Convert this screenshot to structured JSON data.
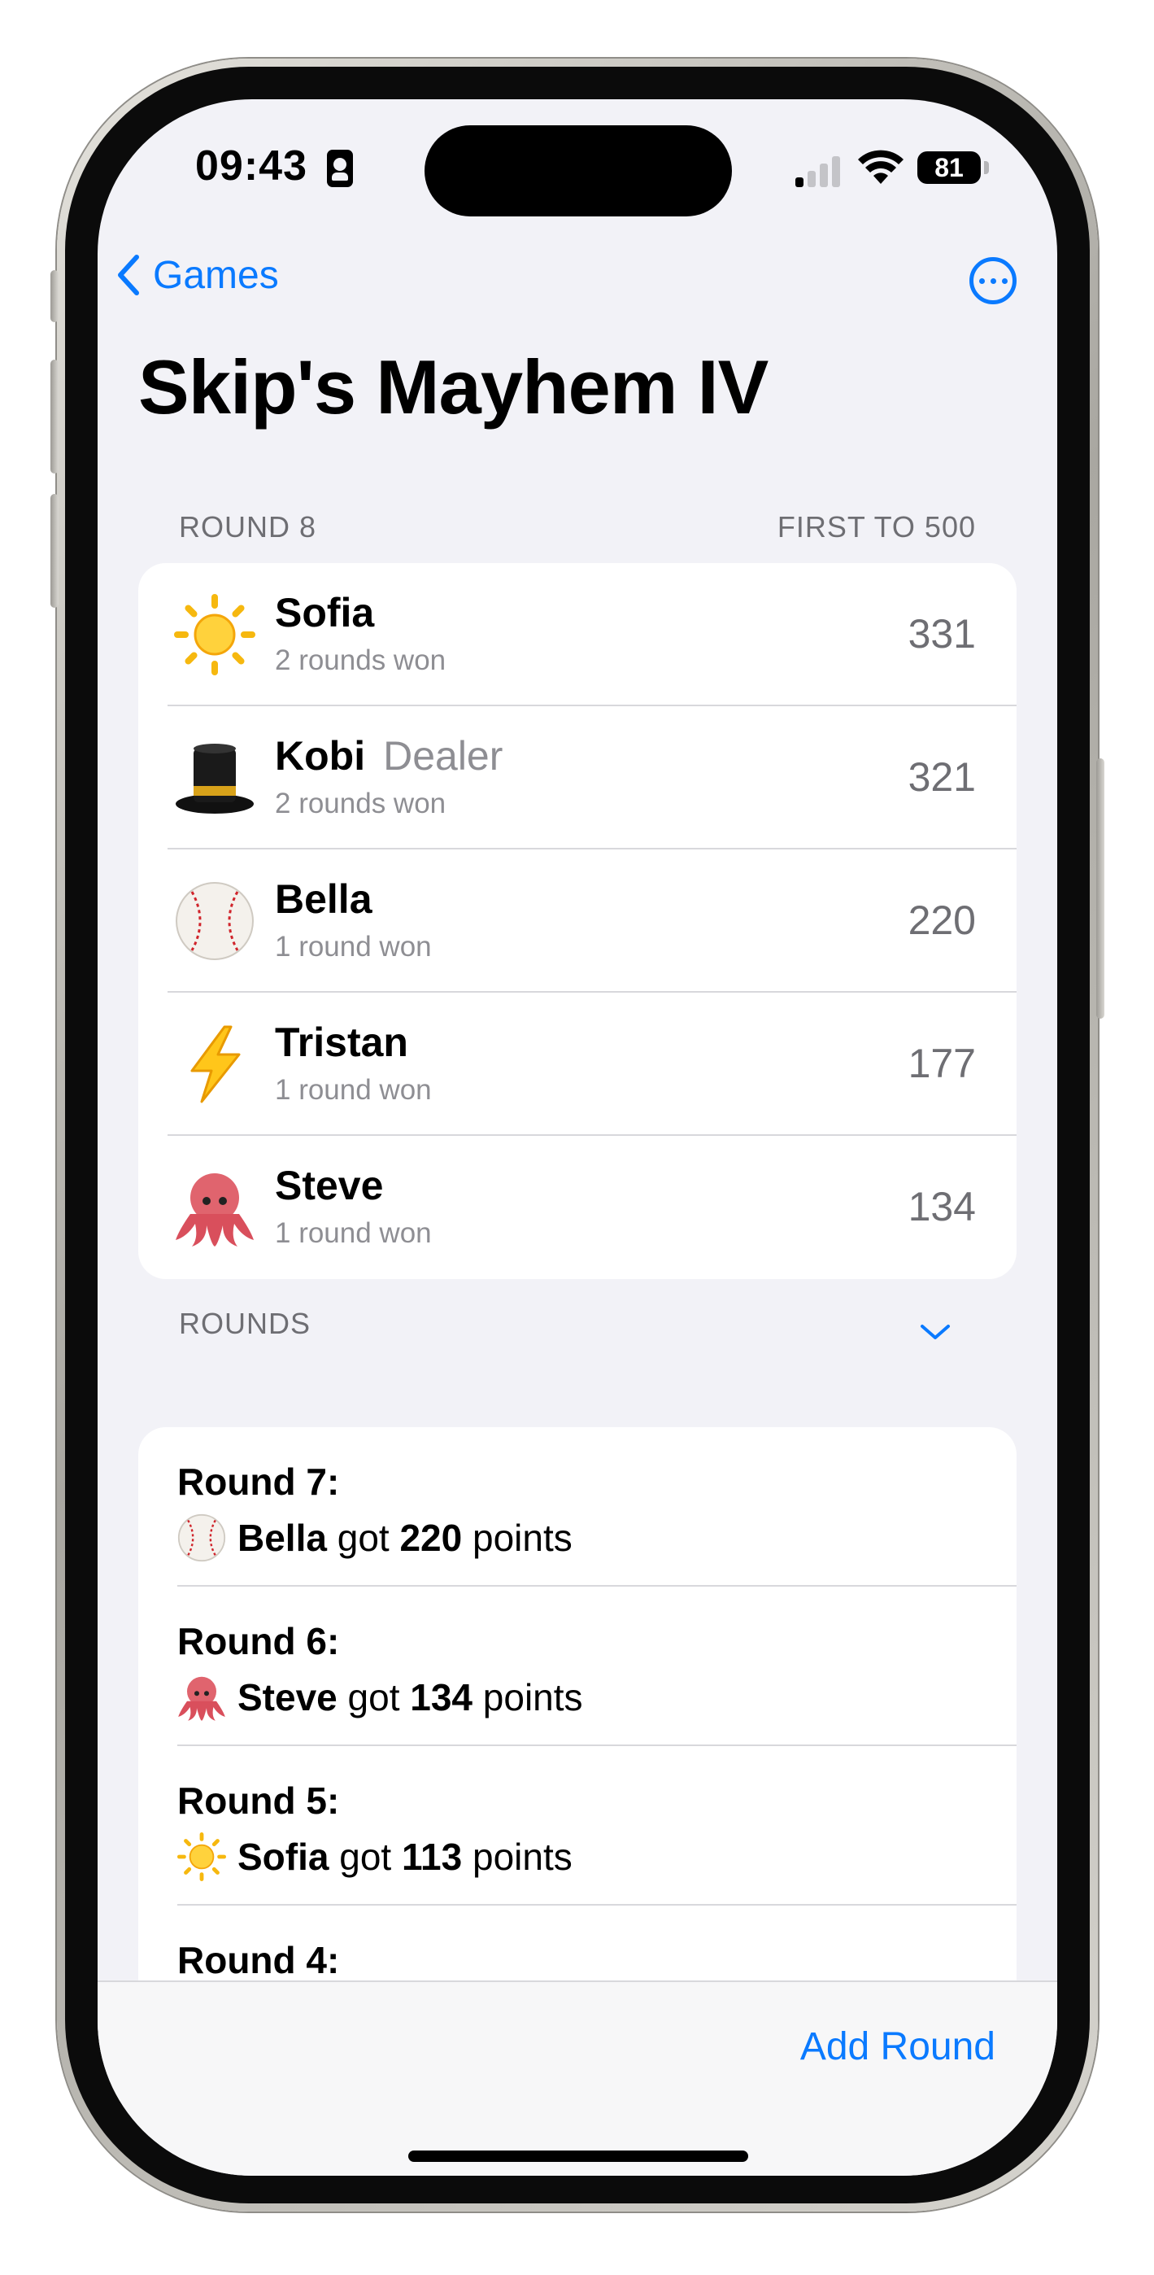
{
  "status_bar": {
    "time": "09:43",
    "battery": "81"
  },
  "nav": {
    "back_label": "Games"
  },
  "page": {
    "title": "Skip's Mayhem IV"
  },
  "standings": {
    "round_label": "ROUND 8",
    "goal_label": "FIRST TO 500",
    "players": [
      {
        "emoji": "sun-icon",
        "name": "Sofia",
        "role": "",
        "wins": "2 rounds won",
        "score": "331"
      },
      {
        "emoji": "top-hat-icon",
        "name": "Kobi",
        "role": "Dealer",
        "wins": "2 rounds won",
        "score": "321"
      },
      {
        "emoji": "baseball-icon",
        "name": "Bella",
        "role": "",
        "wins": "1 round won",
        "score": "220"
      },
      {
        "emoji": "lightning-icon",
        "name": "Tristan",
        "role": "",
        "wins": "1 round won",
        "score": "177"
      },
      {
        "emoji": "octopus-icon",
        "name": "Steve",
        "role": "",
        "wins": "1 round won",
        "score": "134"
      }
    ]
  },
  "rounds": {
    "header": "ROUNDS",
    "items": [
      {
        "label": "Round 7:",
        "emoji": "baseball-icon",
        "player": "Bella",
        "verb": "got",
        "points": "220",
        "unit": "points"
      },
      {
        "label": "Round 6:",
        "emoji": "octopus-icon",
        "player": "Steve",
        "verb": "got",
        "points": "134",
        "unit": "points"
      },
      {
        "label": "Round 5:",
        "emoji": "sun-icon",
        "player": "Sofia",
        "verb": "got",
        "points": "113",
        "unit": "points"
      },
      {
        "label": "Round 4:"
      }
    ]
  },
  "toolbar": {
    "add_round_label": "Add Round"
  },
  "colors": {
    "accent": "#0a7aff",
    "background": "#f2f2f7"
  }
}
